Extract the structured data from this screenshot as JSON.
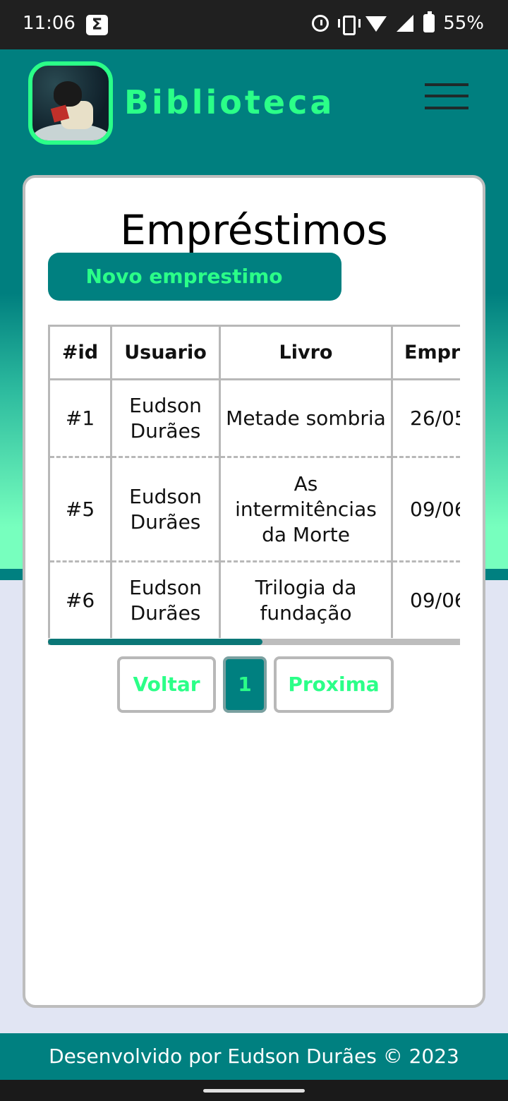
{
  "status_bar": {
    "time": "11:06",
    "battery": "55%",
    "icons": [
      "sigma-icon",
      "alarm-icon",
      "vibrate-icon",
      "wifi-icon",
      "signal-icon",
      "battery-icon"
    ]
  },
  "header": {
    "brand": "Biblioteca",
    "logo": "reading-person-logo",
    "menu_icon": "hamburger-menu-icon"
  },
  "main": {
    "title": "Empréstimos",
    "new_button": "Novo emprestimo",
    "table": {
      "headers": [
        "#id",
        "Usuario",
        "Livro",
        "Empr"
      ],
      "rows": [
        {
          "id": "#1",
          "user": "Eudson Durães",
          "book": "Metade sombria",
          "date": "26/05"
        },
        {
          "id": "#5",
          "user": "Eudson Durães",
          "book": "As intermitências da Morte",
          "date": "09/06"
        },
        {
          "id": "#6",
          "user": "Eudson Durães",
          "book": "Trilogia da fundação",
          "date": "09/06"
        }
      ]
    },
    "horizontal_scroll_fraction": 0.52,
    "pagination": {
      "prev": "Voltar",
      "current": "1",
      "next": "Proxima"
    }
  },
  "footer": {
    "text": "Desenvolvido por Eudson Durães © 2023"
  },
  "colors": {
    "primary": "#008080",
    "accent": "#2bff88",
    "gradient_end": "#77ffbe",
    "page_bg": "#e1e5f3"
  }
}
